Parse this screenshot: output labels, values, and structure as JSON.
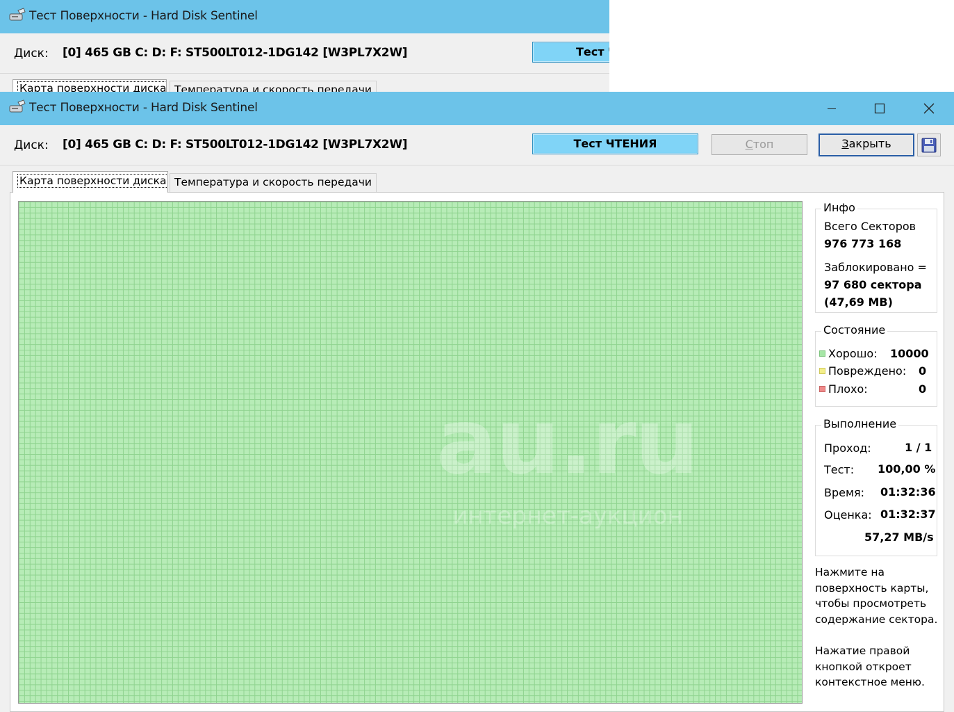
{
  "window": {
    "title": "Тест Поверхности - Hard Disk Sentinel",
    "disk_label": "Диск:",
    "disk_name": "[0] 465 GB C: D: F: ST500LT012-1DG142 [W3PL7X2W]"
  },
  "back_window": {
    "title": "Тест Поверхности - Hard Disk Sentinel",
    "disk_label": "Диск:",
    "disk_name": "[0] 465 GB C: D: F: ST500LT012-1DG142 [W3PL7X2W]",
    "test_button_label": "Тест Ч",
    "tab1": "Карта поверхности диска",
    "tab2": "Температура и скорость передачи"
  },
  "toolbar": {
    "test_button": "Тест ЧТЕНИЯ",
    "stop_first_letter": "С",
    "stop_rest": "топ",
    "close_first_letter": "З",
    "close_rest": "акрыть",
    "save_icon": "floppy-disk-icon"
  },
  "tabs": [
    {
      "label": "Карта поверхности диска",
      "active": true
    },
    {
      "label": "Температура и скорость передачи",
      "active": false
    }
  ],
  "info": {
    "title": "Инфо",
    "total_sectors_label": "Всего Секторов",
    "total_sectors_value": "976 773 168",
    "blocked_label": "Заблокировано =",
    "blocked_sectors": "97 680 сектора",
    "blocked_size": "(47,69 MB)"
  },
  "state": {
    "title": "Состояние",
    "good_label": "Хорошо:",
    "good_value": "10000",
    "damaged_label": "Повреждено:",
    "damaged_value": "0",
    "bad_label": "Плохо:",
    "bad_value": "0",
    "colors": {
      "good": "#a6e6a6",
      "damaged": "#f4ef8a",
      "bad": "#f08a8a"
    }
  },
  "progress": {
    "title": "Выполнение",
    "pass_label": "Проход:",
    "pass_value": "1 / 1",
    "test_label": "Тест:",
    "test_value": "100,00 %",
    "time_label": "Время:",
    "time_value": "01:32:36",
    "estimate_label": "Оценка:",
    "estimate_value": "01:32:37",
    "speed": "57,27 MB/s"
  },
  "hints": {
    "left_click": "Нажмите на поверхность карты, чтобы просмотреть содержание сектора.",
    "right_click": "Нажатие правой кнопкой откроет контекстное меню."
  },
  "watermark": {
    "main": "au.ru",
    "sub": "интернет-аукцион"
  },
  "icons": {
    "app": "hard-disk-sentinel-icon",
    "minimize": "minimize-icon",
    "maximize": "maximize-icon",
    "close": "close-icon"
  },
  "colors": {
    "titlebar": "#6cc3e9",
    "test_button": "#80d4f7",
    "map_fill": "#b7ecb7",
    "map_grid": "#8fd38f"
  }
}
